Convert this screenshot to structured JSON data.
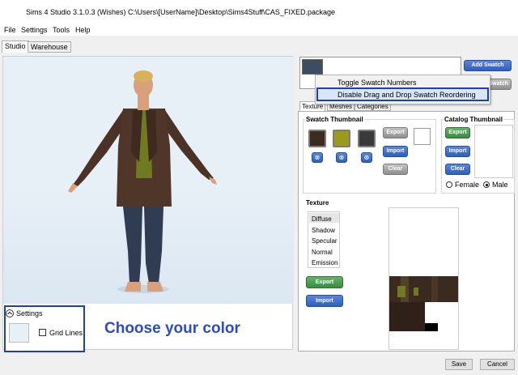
{
  "window": {
    "title": "Sims 4 Studio 3.1.0.3 (Wishes)  C:\\Users\\[UserName]\\Desktop\\Sims4Stuff\\CAS_FIXED.package"
  },
  "menu": {
    "items": [
      "File",
      "Settings",
      "Tools",
      "Help"
    ]
  },
  "main_tabs": [
    "Studio",
    "Warehouse"
  ],
  "viewport": {
    "settings_label": "Settings",
    "gridlines_label": "Grid Lines",
    "annotation": "Choose your color"
  },
  "swatch_panel": {
    "add_swatch": "Add Swatch",
    "swatch_partial": "Swatch",
    "context_menu": [
      "Toggle Swatch Numbers",
      "Disable Drag and Drop Swatch Reordering"
    ]
  },
  "inner_tabs": [
    "Texture",
    "Meshes",
    "Categories"
  ],
  "swatch_thumbnail": {
    "title": "Swatch Thumbnail",
    "colors": [
      "#3d2b22",
      "#9b9a1c",
      "#3a3a3a"
    ],
    "export": "Export",
    "import": "Import",
    "clear": "Clear",
    "remove_glyph": "⊗"
  },
  "catalog_thumbnail": {
    "title": "Catalog Thumbnail",
    "export": "Export",
    "import": "Import",
    "clear": "Clear",
    "female": "Female",
    "male": "Male",
    "selected": "Male"
  },
  "texture": {
    "title": "Texture",
    "items": [
      "Diffuse",
      "Shadow",
      "Specular",
      "Normal",
      "Emission"
    ],
    "selected": "Diffuse",
    "export": "Export",
    "import": "Import"
  },
  "footer": {
    "save": "Save",
    "cancel": "Cancel"
  },
  "colors": {
    "highlight_border": "#1f3fb6",
    "annotation_text": "#2d4cc4"
  }
}
